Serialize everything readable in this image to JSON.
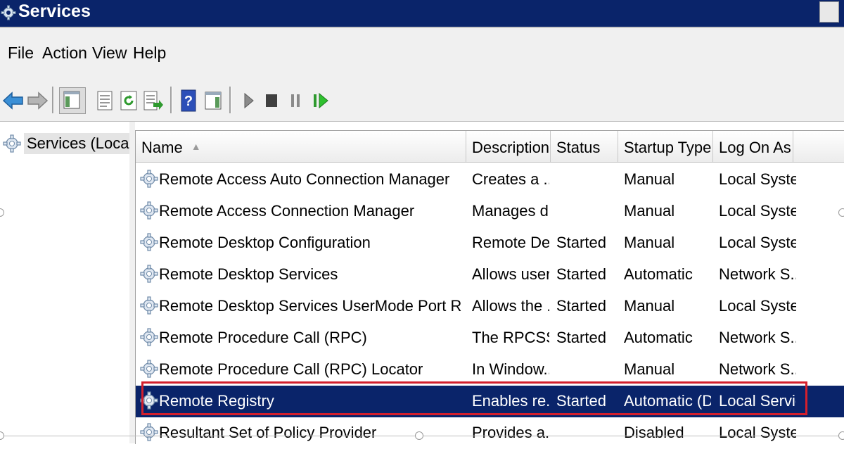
{
  "window": {
    "title": "Services",
    "icon": "services-gear-icon"
  },
  "menu": [
    {
      "label": "File"
    },
    {
      "label": "Action"
    },
    {
      "label": "View"
    },
    {
      "label": "Help"
    }
  ],
  "toolbar": {
    "icons": [
      "back-icon",
      "forward-icon",
      "show-hide-console-tree-icon",
      "properties-icon",
      "refresh-icon",
      "export-list-icon",
      "help-icon",
      "show-hide-action-pane-icon",
      "start-service-icon",
      "stop-service-icon",
      "pause-service-icon",
      "restart-service-icon"
    ]
  },
  "tree": {
    "item_label": "Services (Local)"
  },
  "columns": {
    "name": "Name",
    "description": "Description",
    "status": "Status",
    "startup_type": "Startup Type",
    "log_on_as": "Log On As"
  },
  "rows": [
    {
      "name": "Remote Access Auto Connection Manager",
      "description": "Creates a ...",
      "status": "",
      "startup": "Manual",
      "logon": "Local System"
    },
    {
      "name": "Remote Access Connection Manager",
      "description": "Manages di...",
      "status": "",
      "startup": "Manual",
      "logon": "Local System"
    },
    {
      "name": "Remote Desktop Configuration",
      "description": "Remote De...",
      "status": "Started",
      "startup": "Manual",
      "logon": "Local System"
    },
    {
      "name": "Remote Desktop Services",
      "description": "Allows user...",
      "status": "Started",
      "startup": "Automatic",
      "logon": "Network S..."
    },
    {
      "name": "Remote Desktop Services UserMode Port Redirector",
      "description": "Allows the ...",
      "status": "Started",
      "startup": "Manual",
      "logon": "Local System"
    },
    {
      "name": "Remote Procedure Call (RPC)",
      "description": "The RPCSS...",
      "status": "Started",
      "startup": "Automatic",
      "logon": "Network S..."
    },
    {
      "name": "Remote Procedure Call (RPC) Locator",
      "description": "In Window...",
      "status": "",
      "startup": "Manual",
      "logon": "Network S..."
    },
    {
      "name": "Remote Registry",
      "description": "Enables re...",
      "status": "Started",
      "startup": "Automatic (D...",
      "logon": "Local Service",
      "selected": true
    },
    {
      "name": "Resultant Set of Policy Provider",
      "description": "Provides a...",
      "status": "",
      "startup": "Disabled",
      "logon": "Local System"
    }
  ],
  "colors": {
    "selection": "#0a246a",
    "highlight_outline": "#d41f2c",
    "title_bar": "#0a246a"
  }
}
